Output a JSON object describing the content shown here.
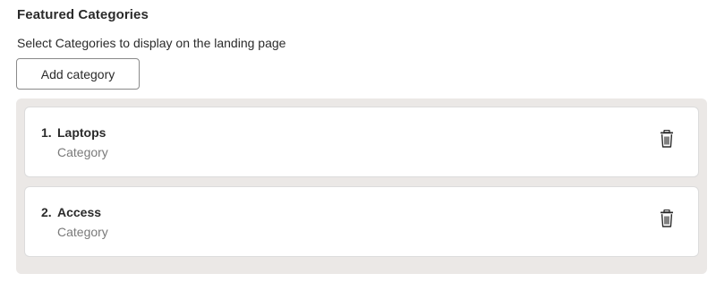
{
  "section": {
    "title": "Featured Categories",
    "description": "Select Categories to display on the landing page",
    "add_button_label": "Add category"
  },
  "categories": [
    {
      "index": "1.",
      "name": "Laptops",
      "type": "Category",
      "action_icon": "trash-icon"
    },
    {
      "index": "2.",
      "name": "Access",
      "type": "Category",
      "action_icon": "trash-icon"
    }
  ],
  "colors": {
    "panel_bg": "#ebe8e6",
    "card_bg": "#ffffff",
    "muted_text": "#7a7a7a"
  }
}
